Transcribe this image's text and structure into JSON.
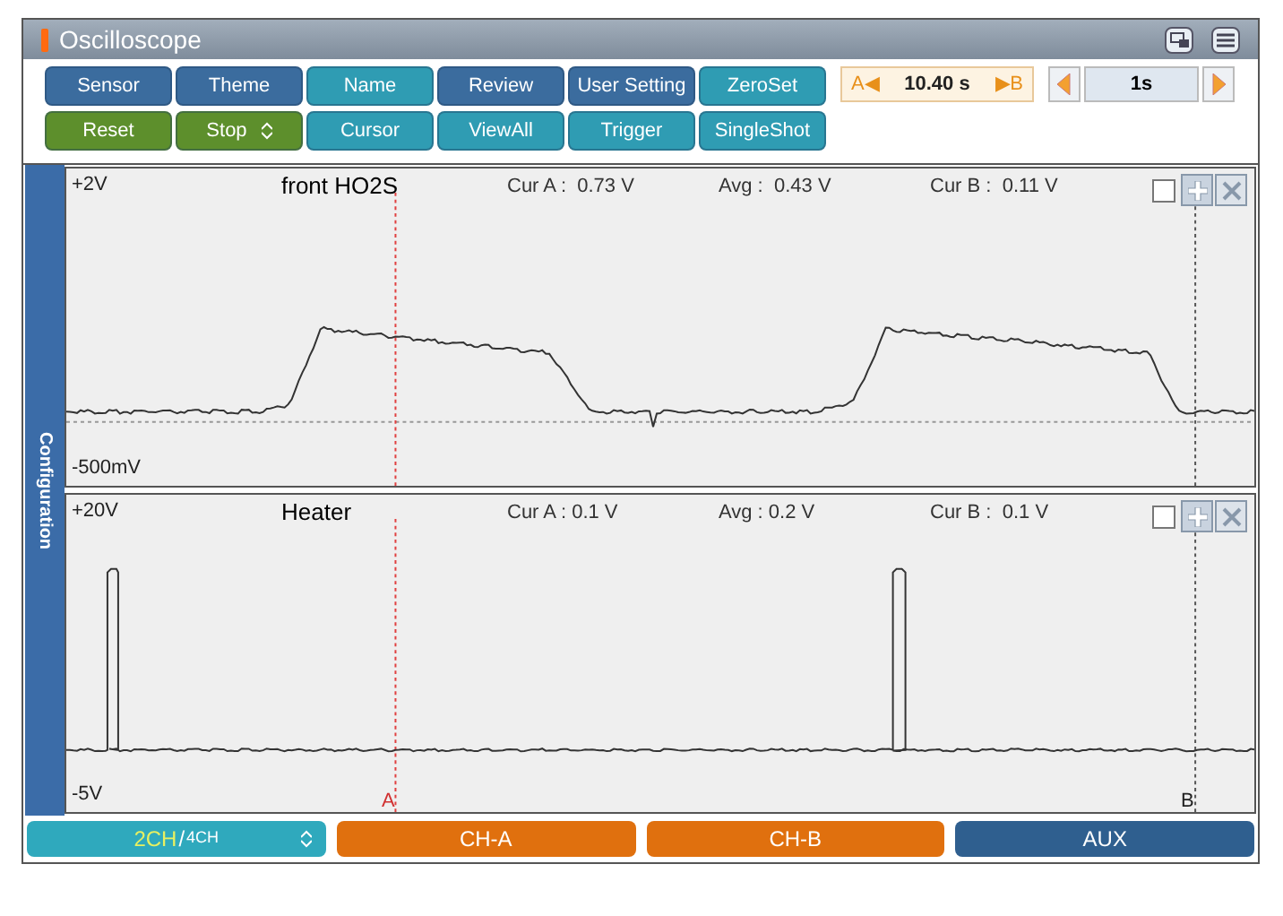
{
  "window": {
    "title": "Oscilloscope"
  },
  "toolbar": {
    "rows": [
      [
        {
          "label": "Sensor",
          "color": "#3b6c9e"
        },
        {
          "label": "Theme",
          "color": "#3b6c9e"
        },
        {
          "label": "Name",
          "color": "#2f9cb3"
        },
        {
          "label": "Review",
          "color": "#3b6c9e"
        },
        {
          "label": "User Setting",
          "color": "#3b6c9e"
        },
        {
          "label": "ZeroSet",
          "color": "#2f9cb3"
        }
      ],
      [
        {
          "label": "Reset",
          "color": "#5d8f2c"
        },
        {
          "label": "Stop",
          "color": "#5d8f2c",
          "spinner": true
        },
        {
          "label": "Cursor",
          "color": "#2f9cb3"
        },
        {
          "label": "ViewAll",
          "color": "#2f9cb3"
        },
        {
          "label": "Trigger",
          "color": "#2f9cb3"
        },
        {
          "label": "SingleShot",
          "color": "#2f9cb3"
        }
      ]
    ]
  },
  "cursor_span": {
    "left": "A◀",
    "value": "10.40 s",
    "right": "▶B"
  },
  "time_div": {
    "value": "1s"
  },
  "side_tab": {
    "label": "Configuration"
  },
  "channels": [
    {
      "kind": "analog",
      "top": "+2V",
      "bottom": "-500mV",
      "name": "front HO2S",
      "cur_a": "Cur A :  0.73 V",
      "avg": "Avg :  0.43 V",
      "cur_b": "Cur B :  0.11 V",
      "checked": false
    },
    {
      "kind": "pulse",
      "top": "+20V",
      "bottom": "-5V",
      "name": "Heater",
      "cur_a": "Cur A : 0.1 V",
      "avg": "Avg : 0.2 V",
      "cur_b": "Cur B :  0.1 V",
      "checked": false,
      "cursor_a_label": "A",
      "cursor_b_label": "B"
    }
  ],
  "bottom_tabs": [
    {
      "kind": "channels",
      "primary": "2CH",
      "separator": "/",
      "secondary": "4CH",
      "color": "#2fa9bd"
    },
    {
      "kind": "plain",
      "label": "CH-A",
      "color": "#e0700e"
    },
    {
      "kind": "plain",
      "label": "CH-B",
      "color": "#e0700e"
    },
    {
      "kind": "plain",
      "label": "AUX",
      "color": "#2f5f8f"
    }
  ]
}
